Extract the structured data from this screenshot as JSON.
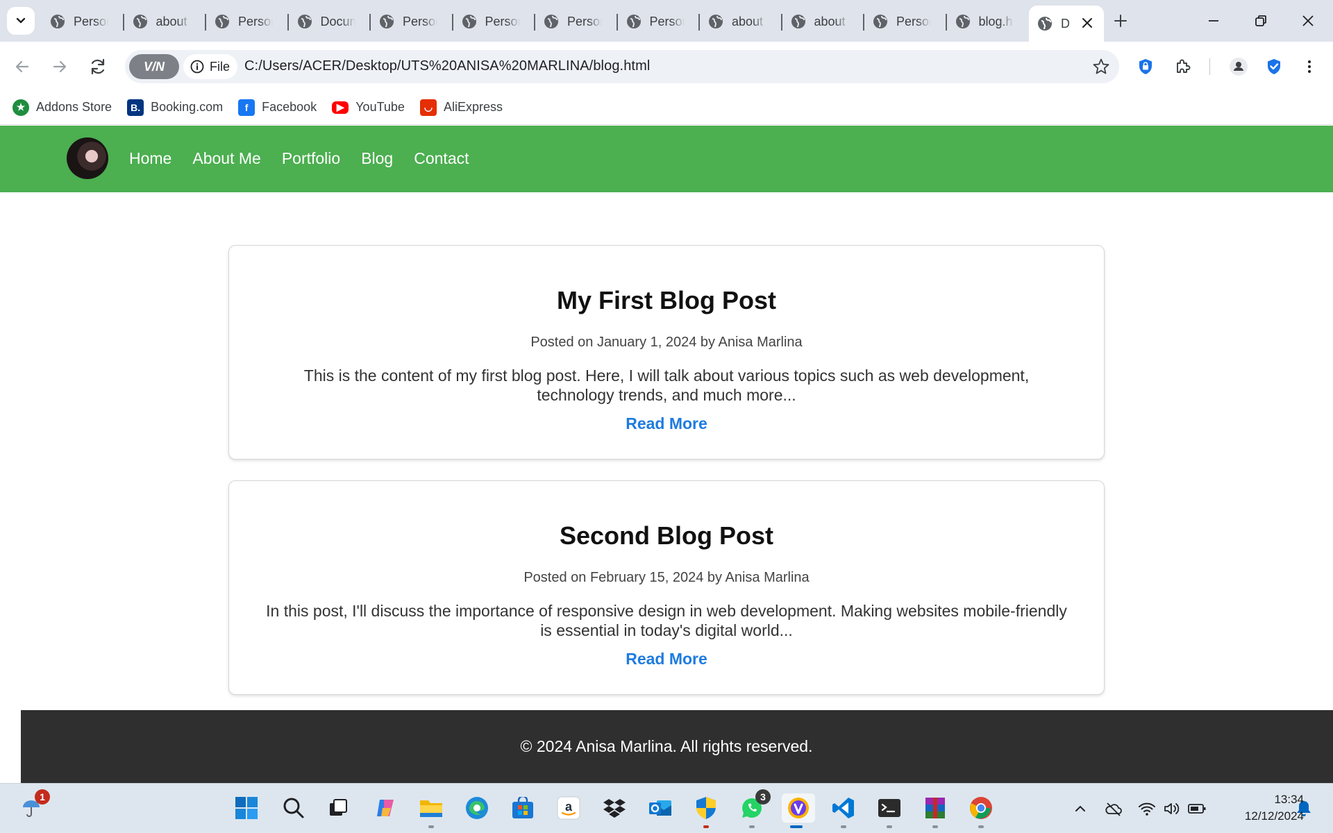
{
  "browser": {
    "tabs": [
      {
        "title": "Person"
      },
      {
        "title": "about"
      },
      {
        "title": "Person"
      },
      {
        "title": "Docum"
      },
      {
        "title": "Person"
      },
      {
        "title": "Person"
      },
      {
        "title": "Person"
      },
      {
        "title": "Person"
      },
      {
        "title": "about"
      },
      {
        "title": "about"
      },
      {
        "title": "Person"
      },
      {
        "title": "blog.h"
      }
    ],
    "active_tab_title": "D",
    "vpn_label": "V/N",
    "file_chip_label": "File",
    "url": "C:/Users/ACER/Desktop/UTS%20ANISA%20MARLINA/blog.html",
    "bookmarks": [
      {
        "label": "Addons Store",
        "icon": "addons-store-icon",
        "color": "#1e8e3e"
      },
      {
        "label": "Booking.com",
        "icon": "booking-icon",
        "color": "#003580"
      },
      {
        "label": "Facebook",
        "icon": "facebook-icon",
        "color": "#1877f2"
      },
      {
        "label": "YouTube",
        "icon": "youtube-icon",
        "color": "#ff0000"
      },
      {
        "label": "AliExpress",
        "icon": "aliexpress-icon",
        "color": "#e62e04"
      }
    ]
  },
  "site": {
    "header_color": "#4caf50",
    "nav": [
      "Home",
      "About Me",
      "Portfolio",
      "Blog",
      "Contact"
    ],
    "posts": [
      {
        "title": "My First Blog Post",
        "meta": "Posted on January 1, 2024 by Anisa Marlina",
        "excerpt": "This is the content of my first blog post. Here, I will talk about various topics such as web development, technology trends, and much more...",
        "read_more": "Read More"
      },
      {
        "title": "Second Blog Post",
        "meta": "Posted on February 15, 2024 by Anisa Marlina",
        "excerpt": "In this post, I'll discuss the importance of responsive design in web development. Making websites mobile-friendly is essential in today's digital world...",
        "read_more": "Read More"
      }
    ],
    "link_color": "#1e7be0",
    "footer_text": "© 2024 Anisa Marlina. All rights reserved.",
    "footer_color": "#2f2f2f"
  },
  "taskbar": {
    "weather_badge": "1",
    "whatsapp_badge": "3",
    "clock_time": "13:34",
    "clock_date": "12/12/2024"
  }
}
